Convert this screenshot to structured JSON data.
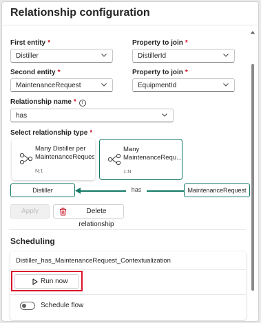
{
  "header": {
    "title": "Relationship configuration"
  },
  "form": {
    "first_entity": {
      "label": "First entity",
      "value": "Distiller"
    },
    "first_property": {
      "label": "Property to join",
      "value": "DistillerId"
    },
    "second_entity": {
      "label": "Second entity",
      "value": "MaintenanceRequest"
    },
    "second_property": {
      "label": "Property to join",
      "value": "EquipmentId"
    },
    "relationship_name": {
      "label": "Relationship name",
      "value": "has"
    },
    "required_mark": "*",
    "info_glyph": "i"
  },
  "relationship_type": {
    "label": "Select relationship type",
    "options": [
      {
        "title_line1": "Many Distiller per",
        "title_line2": "MaintenanceRequest",
        "sub": "N:1",
        "selected": false
      },
      {
        "title_line1": "Many",
        "title_line2": "MaintenanceRequ...",
        "sub": "1:N",
        "selected": true
      }
    ]
  },
  "diagram": {
    "left_entity": "Distiller",
    "link_label": "has",
    "right_entity": "MaintenanceRequest"
  },
  "actions": {
    "apply": "Apply",
    "delete": "Delete relationship"
  },
  "scheduling": {
    "title": "Scheduling",
    "job_name": "Distiller_has_MaintenanceRequest_Contextualization",
    "run_now": "Run now",
    "schedule_flow": "Schedule flow",
    "schedule_enabled": false
  },
  "colors": {
    "accent": "#117865",
    "required": "#c50f1f",
    "highlight": "#d9112b",
    "delete": "#c50f1f"
  }
}
